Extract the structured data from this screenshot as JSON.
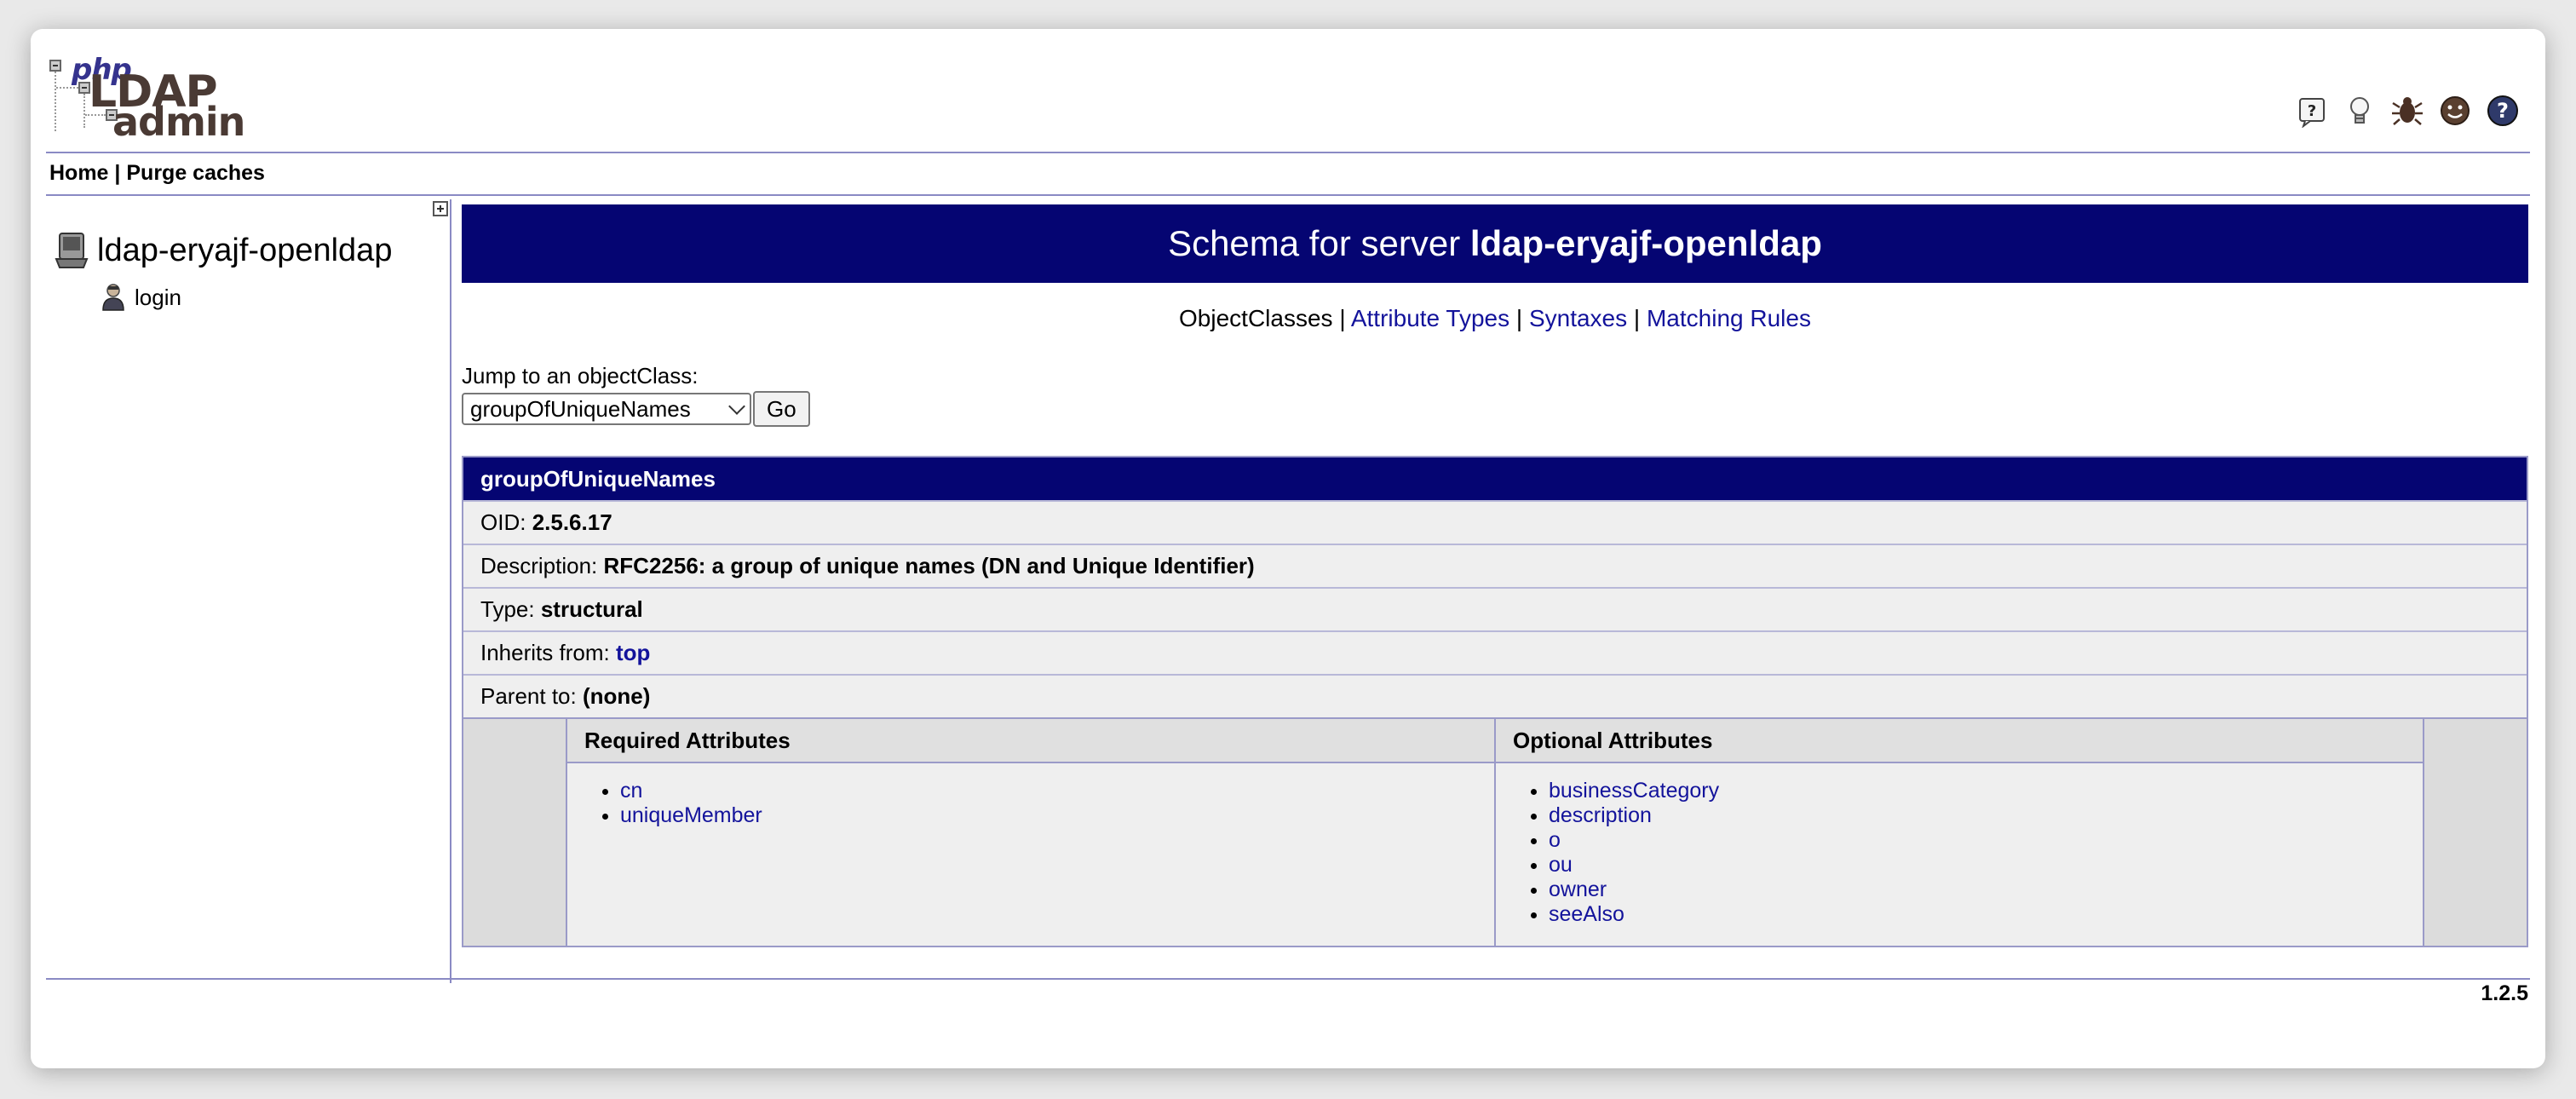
{
  "logo": {
    "line1": "php",
    "line2": "LDAP",
    "line3": "admin"
  },
  "top_icons": [
    "help-question-icon",
    "lightbulb-icon",
    "bug-icon",
    "smiley-icon",
    "help-circle-icon"
  ],
  "menubar": {
    "home": "Home",
    "separator": "|",
    "purge": "Purge caches"
  },
  "tree": {
    "server": "ldap-eryajf-openldap",
    "login": "login"
  },
  "banner": {
    "prefix": "Schema for server",
    "server": "ldap-eryajf-openldap"
  },
  "tabs": {
    "current": "ObjectClasses",
    "sep": "|",
    "attribute_types": "Attribute Types",
    "syntaxes": "Syntaxes",
    "matching_rules": "Matching Rules"
  },
  "jump": {
    "label": "Jump to an objectClass:",
    "selected": "groupOfUniqueNames",
    "go_label": "Go"
  },
  "objectclass": {
    "name": "groupOfUniqueNames",
    "oid_label": "OID:",
    "oid": "2.5.6.17",
    "desc_label": "Description:",
    "desc": "RFC2256: a group of unique names (DN and Unique Identifier)",
    "type_label": "Type:",
    "type": "structural",
    "inherits_label": "Inherits from:",
    "inherits": "top",
    "parent_label": "Parent to:",
    "parent": "(none)"
  },
  "attributes": {
    "required_header": "Required Attributes",
    "required": [
      "cn",
      "uniqueMember"
    ],
    "optional_header": "Optional Attributes",
    "optional": [
      "businessCategory",
      "description",
      "o",
      "ou",
      "owner",
      "seeAlso"
    ]
  },
  "version": "1.2.5"
}
